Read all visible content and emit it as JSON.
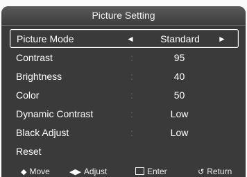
{
  "title": "Picture Setting",
  "menu": [
    {
      "label": "Picture Mode",
      "sep": "",
      "value": "Standard",
      "left_arrow": "◄",
      "right_arrow": "►"
    },
    {
      "label": "Contrast",
      "sep": ":",
      "value": "95"
    },
    {
      "label": "Brightness",
      "sep": ":",
      "value": "40"
    },
    {
      "label": "Color",
      "sep": ":",
      "value": "50"
    },
    {
      "label": "Dynamic Contrast",
      "sep": ":",
      "value": "Low"
    },
    {
      "label": "Black Adjust",
      "sep": ":",
      "value": "Low"
    },
    {
      "label": "Reset",
      "sep": "",
      "value": ""
    }
  ],
  "footer": {
    "move": "Move",
    "adjust": "Adjust",
    "enter": "Enter",
    "return": "Return"
  },
  "icons": {
    "move": "up-down-arrows-icon",
    "adjust": "left-right-arrows-icon",
    "enter": "enter-icon",
    "return": "return-icon"
  }
}
